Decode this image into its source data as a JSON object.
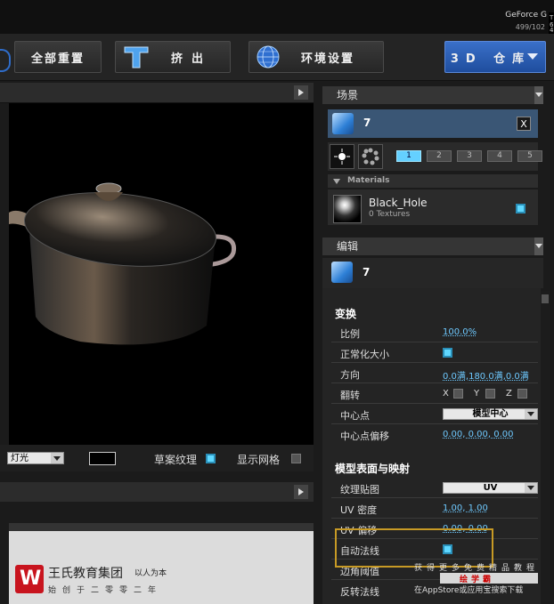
{
  "system": {
    "gpu_label": "GeForce G",
    "gpu_sub": "499/102",
    "side_bits": [
      "T 6",
      "4 N"
    ]
  },
  "toolbar": {
    "reset_label": "全部重置",
    "extrude_label": "挤出",
    "env_label": "环境设置",
    "repo_label": "3D 仓库"
  },
  "viewport": {
    "light_option": "灯光",
    "sketch_texture_label": "草案纹理",
    "show_grid_label": "显示网格"
  },
  "scene": {
    "title": "场景",
    "object_name": "7",
    "close_label": "X",
    "layers": [
      "1",
      "2",
      "3",
      "4",
      "5"
    ],
    "materials_label": "Materials",
    "material_name": "Black_Hole",
    "material_sub": "0 Textures"
  },
  "edit": {
    "title": "编辑",
    "object_name": "7",
    "transform_title": "变换",
    "scale_label": "比例",
    "scale_value": "100.0%",
    "normalize_label": "正常化大小",
    "direction_label": "方向",
    "direction_value": "0.0满,180.0满,0.0满",
    "flip_label": "翻转",
    "flip_axes": [
      "X",
      "Y",
      "Z"
    ],
    "pivot_label": "中心点",
    "pivot_value": "模型中心",
    "pivot_offset_label": "中心点偏移",
    "pivot_offset_value": "0.00, 0.00, 0.00",
    "surface_title": "模型表面与映射",
    "texture_map_label": "纹理贴图",
    "texture_map_value": "UV",
    "uv_density_label": "UV 密度",
    "uv_density_value": "1.00, 1.00",
    "uv_offset_label": "UV 偏移",
    "uv_offset_value": "0.00, 0.00",
    "auto_normals_label": "自动法线",
    "edge_threshold_label": "边角阈值",
    "flip_normals_label": "反转法线"
  },
  "watermark": {
    "company": "王氏教育集团",
    "motto": "以人为本",
    "since": "始创于二零零二年",
    "promo_line1": "获得更多免费精品教程",
    "promo_badge": "绘学霸",
    "promo_line2": "在AppStore或应用宝搜索下载"
  },
  "colors": {
    "accent": "#5fd8ff",
    "repo_button": "#2a5fb8",
    "selected_object": "#3a5675",
    "highlight_box": "#c79a25"
  }
}
